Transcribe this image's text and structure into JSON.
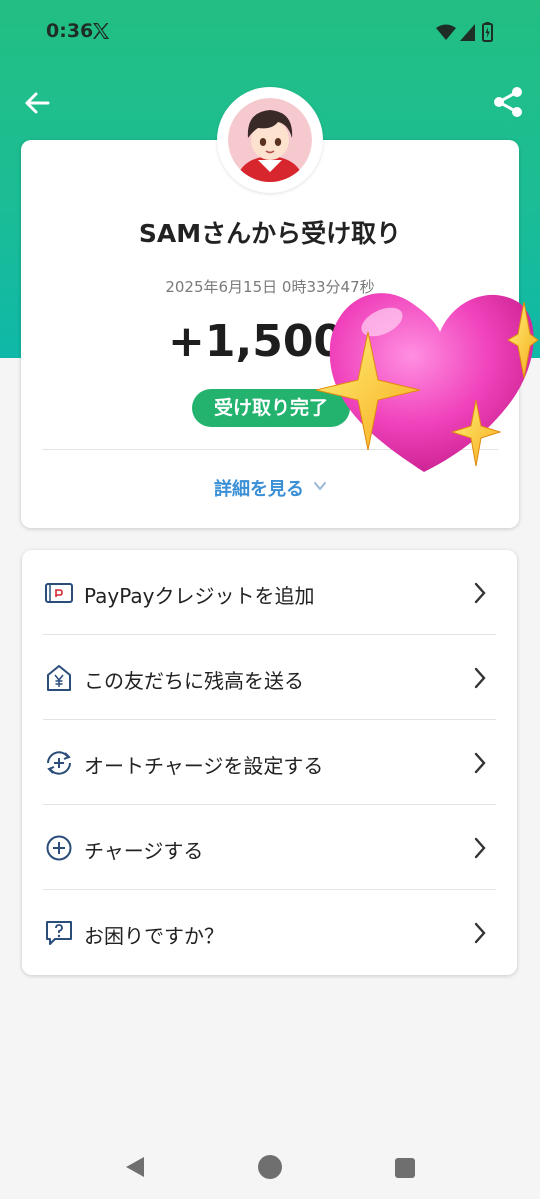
{
  "status_bar": {
    "time": "0:36"
  },
  "receipt": {
    "title": "SAMさんから受け取り",
    "datetime": "2025年6月15日 0時33分47秒",
    "amount": "+1,500",
    "status": "受け取り完了",
    "detail_link": "詳細を見る"
  },
  "menu": {
    "items": [
      {
        "label": "PayPayクレジットを追加",
        "icon": "credit-card-icon"
      },
      {
        "label": "この友だちに残高を送る",
        "icon": "send-yen-icon"
      },
      {
        "label": "オートチャージを設定する",
        "icon": "auto-charge-icon"
      },
      {
        "label": "チャージする",
        "icon": "plus-circle-icon"
      },
      {
        "label": "お困りですか？",
        "icon": "help-chat-icon"
      }
    ]
  },
  "colors": {
    "header_green": "#22be82",
    "badge_green": "#23b36e",
    "link_blue": "#3a8fd6",
    "icon_navy": "#2a4d7a"
  }
}
